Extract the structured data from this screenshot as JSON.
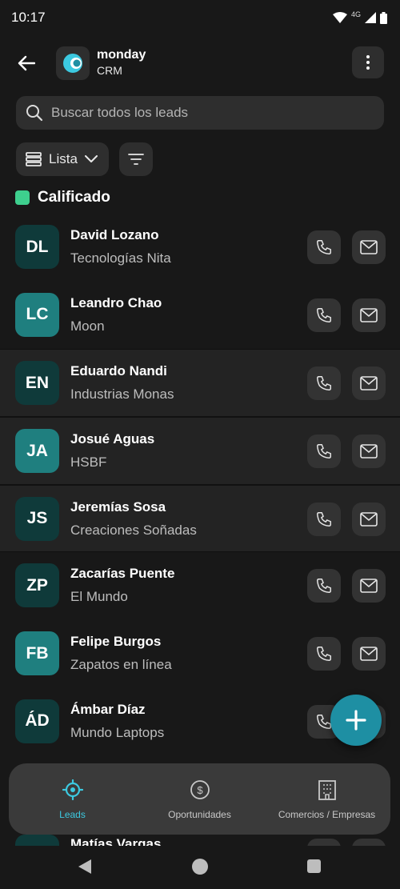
{
  "status_bar": {
    "time": "10:17",
    "network": "4G"
  },
  "header": {
    "app_name": "monday",
    "app_subtitle": "CRM"
  },
  "search": {
    "placeholder": "Buscar todos los leads"
  },
  "toolbar": {
    "view_label": "Lista"
  },
  "group": {
    "title": "Calificado",
    "color": "#3ecf8e"
  },
  "leads": [
    {
      "initials": "DL",
      "name": "David Lozano",
      "company": "Tecnologías Nita",
      "avatar_style": "dark",
      "highlighted": false
    },
    {
      "initials": "LC",
      "name": "Leandro Chao",
      "company": "Moon",
      "avatar_style": "light",
      "highlighted": false
    },
    {
      "initials": "EN",
      "name": "Eduardo Nandi",
      "company": "Industrias Monas",
      "avatar_style": "dark",
      "highlighted": true
    },
    {
      "initials": "JA",
      "name": "Josué Aguas",
      "company": "HSBF",
      "avatar_style": "light",
      "highlighted": true
    },
    {
      "initials": "JS",
      "name": "Jeremías Sosa",
      "company": "Creaciones Soñadas",
      "avatar_style": "dark",
      "highlighted": true
    },
    {
      "initials": "ZP",
      "name": "Zacarías Puente",
      "company": "El Mundo",
      "avatar_style": "dark",
      "highlighted": false
    },
    {
      "initials": "FB",
      "name": "Felipe Burgos",
      "company": "Zapatos en línea",
      "avatar_style": "light",
      "highlighted": false
    },
    {
      "initials": "ÁD",
      "name": "Ámbar Díaz",
      "company": "Mundo Laptops",
      "avatar_style": "dark",
      "highlighted": false
    }
  ],
  "partial_lead": {
    "name": "Matías Vargas"
  },
  "bottom_nav": {
    "items": [
      {
        "label": "Leads",
        "icon": "target-icon",
        "active": true
      },
      {
        "label": "Oportunidades",
        "icon": "dollar-icon",
        "active": false
      },
      {
        "label": "Comercios / Empresas",
        "icon": "building-icon",
        "active": false
      }
    ]
  },
  "colors": {
    "accent": "#3cc9e0",
    "fab": "#1e8fa3",
    "background": "#181818"
  }
}
